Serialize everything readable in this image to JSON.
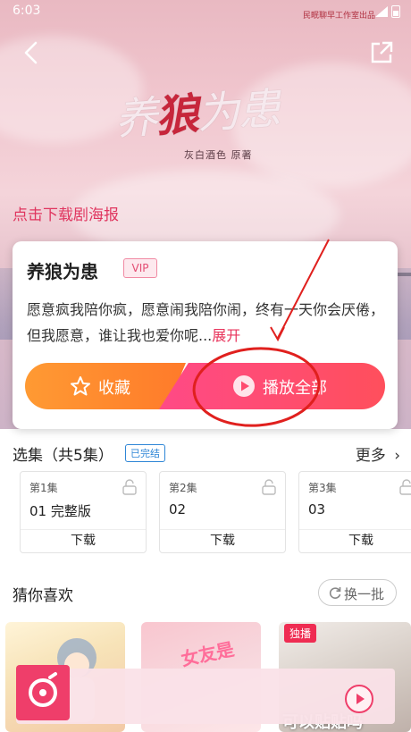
{
  "status_bar": {
    "time": "6:03",
    "banner": "民眠聊早工作室出品"
  },
  "poster": {
    "title_part1": "养",
    "title_accent": "狼",
    "title_part2": "为患",
    "credit": "灰白酒色 原著",
    "download_link": "点击下载剧海报"
  },
  "drama": {
    "title": "养狼为患",
    "vip_label": "VIP",
    "description": "愿意疯我陪你疯，愿意闹我陪你闹，终有一天你会厌倦，但我愿意，谁让我也爱你呢...",
    "expand_label": "展开",
    "favorite_label": "收藏",
    "play_all_label": "播放全部"
  },
  "episodes": {
    "header": "选集（共5集）",
    "status": "已完结",
    "more_label": "更多",
    "items": [
      {
        "num": "第1集",
        "name": "01 完整版",
        "download": "下载"
      },
      {
        "num": "第2集",
        "name": "02",
        "download": "下载"
      },
      {
        "num": "第3集",
        "name": "03",
        "download": "下载"
      }
    ]
  },
  "recommend": {
    "title": "猜你喜欢",
    "refresh_label": "换一批",
    "items": [
      {
        "badge": "",
        "text": ""
      },
      {
        "badge": "",
        "text": "女友是"
      },
      {
        "badge": "独播",
        "text": "可以贴贴吗"
      }
    ]
  },
  "colors": {
    "accent": "#e8335b",
    "favorite_orange": "#ff8a2e",
    "play_pink": "#ff4a6e",
    "annotation_red": "#e0201e",
    "completed_blue": "#2e86d6"
  }
}
